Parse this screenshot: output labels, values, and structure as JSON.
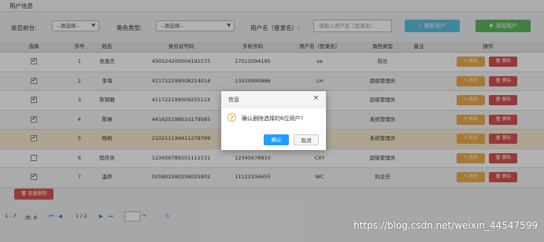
{
  "header": {
    "title": "用户信息"
  },
  "filters": {
    "frontend_label": "是否前台:",
    "frontend_value": "--请选择--",
    "role_label": "角色类型:",
    "role_value": "--请选择--",
    "username_label": "用户名（登录名）:",
    "username_placeholder": "请输入用户名（登录名）",
    "search_label": "搜索用户",
    "add_label": "添加用户"
  },
  "table": {
    "columns": [
      "选择",
      "序号",
      "姓名",
      "身份证号码",
      "手机号码",
      "用户名（登录名）",
      "角色类型",
      "备注",
      "操作"
    ],
    "rows": [
      {
        "checked": true,
        "no": "1",
        "name": "张逸杰",
        "id_card": "430524200004191575",
        "phone": "17512094195",
        "username": "sa",
        "role": "院长",
        "remark": ""
      },
      {
        "checked": true,
        "no": "2",
        "name": "李海",
        "id_card": "411722199508214014",
        "phone": "13520995886",
        "username": "LH",
        "role": "超级管理员",
        "remark": ""
      },
      {
        "checked": true,
        "no": "3",
        "name": "陈锦雅",
        "id_card": "41172219900925511X",
        "phone": "13129990000",
        "username": "",
        "role": "超级管理员",
        "remark": ""
      },
      {
        "checked": true,
        "no": "4",
        "name": "陈琳",
        "id_card": "441625198010179585",
        "phone": "",
        "username": "",
        "role": "系统管理员",
        "remark": ""
      },
      {
        "checked": true,
        "no": "5",
        "name": "杨帆",
        "id_card": "210211199411279799",
        "phone": "",
        "username": "",
        "role": "系统管理员",
        "remark": ""
      },
      {
        "checked": false,
        "no": "6",
        "name": "程序员",
        "id_card": "123456789101112131",
        "phone": "12345678910",
        "username": "CXY",
        "role": "超级管理员",
        "remark": ""
      },
      {
        "checked": true,
        "no": "7",
        "name": "温存",
        "id_card": "025802580258025802",
        "phone": "11122334455",
        "username": "WC",
        "role": "科主任",
        "remark": ""
      }
    ],
    "edit_label": "修改",
    "delete_label": "删除"
  },
  "batch_delete_label": "批量删除",
  "pager": {
    "range": "1 - 7",
    "total": "共: 8",
    "page": "1 / 2"
  },
  "dialog": {
    "title": "信息",
    "close": "×",
    "icon": "?",
    "message": "确认删除选择的6位用户?",
    "ok_label": "确认",
    "cancel_label": "取消"
  },
  "watermark": "https://blog.csdn.net/weixin_44547599"
}
